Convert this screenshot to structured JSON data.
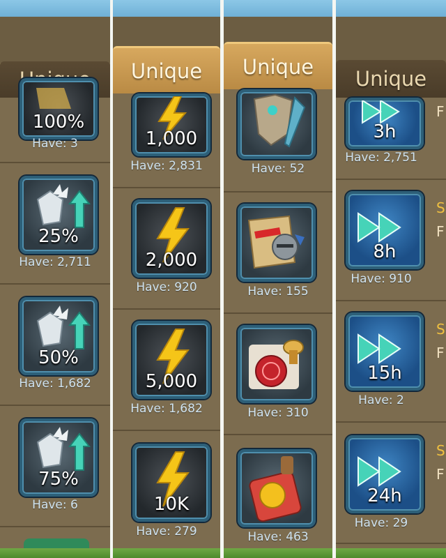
{
  "columns": [
    {
      "tab_label": "Unique",
      "items": [
        {
          "amount": "100%",
          "have": "Have: 3",
          "icon": "gear-boost-icon"
        },
        {
          "amount": "25%",
          "have": "Have: 2,711",
          "icon": "gear-boost-icon"
        },
        {
          "amount": "50%",
          "have": "Have: 1,682",
          "icon": "gear-boost-icon"
        },
        {
          "amount": "75%",
          "have": "Have: 6",
          "icon": "gear-boost-icon"
        }
      ]
    },
    {
      "tab_label": "Unique",
      "items": [
        {
          "amount": "1,000",
          "have": "Have: 2,831",
          "icon": "energy-bolt-icon"
        },
        {
          "amount": "2,000",
          "have": "Have: 920",
          "icon": "energy-bolt-icon"
        },
        {
          "amount": "5,000",
          "have": "Have: 1,682",
          "icon": "energy-bolt-icon"
        },
        {
          "amount": "10K",
          "have": "Have: 279",
          "icon": "energy-bolt-icon"
        }
      ]
    },
    {
      "tab_label": "Unique",
      "items": [
        {
          "have": "Have: 52",
          "icon": "armor-quill-icon"
        },
        {
          "have": "Have: 155",
          "icon": "scroll-helmet-icon"
        },
        {
          "have": "Have: 310",
          "icon": "wax-seal-icon"
        },
        {
          "have": "Have: 463",
          "icon": "gold-seal-bottle-icon"
        }
      ]
    },
    {
      "tab_label": "Unique",
      "items": [
        {
          "amount": "3h",
          "have": "Have: 2,751",
          "icon": "speedup-arrows-icon"
        },
        {
          "amount": "8h",
          "have": "Have: 910",
          "icon": "speedup-arrows-icon"
        },
        {
          "amount": "15h",
          "have": "Have: 2",
          "icon": "speedup-arrows-icon"
        },
        {
          "amount": "24h",
          "have": "Have: 29",
          "icon": "speedup-arrows-icon"
        }
      ]
    }
  ],
  "edge_letters": {
    "col4": [
      "F",
      "S",
      "F",
      "S",
      "F",
      "S",
      "F"
    ]
  },
  "colors": {
    "panel_bg": "#7c6c4f",
    "tab_dark": "#4f402c",
    "tab_light": "#c9974f",
    "have_text": "#cfe3f0",
    "icon_border": "#2d5f78",
    "bolt_yellow": "#f5c518",
    "arrow_teal": "#46d3b8"
  }
}
